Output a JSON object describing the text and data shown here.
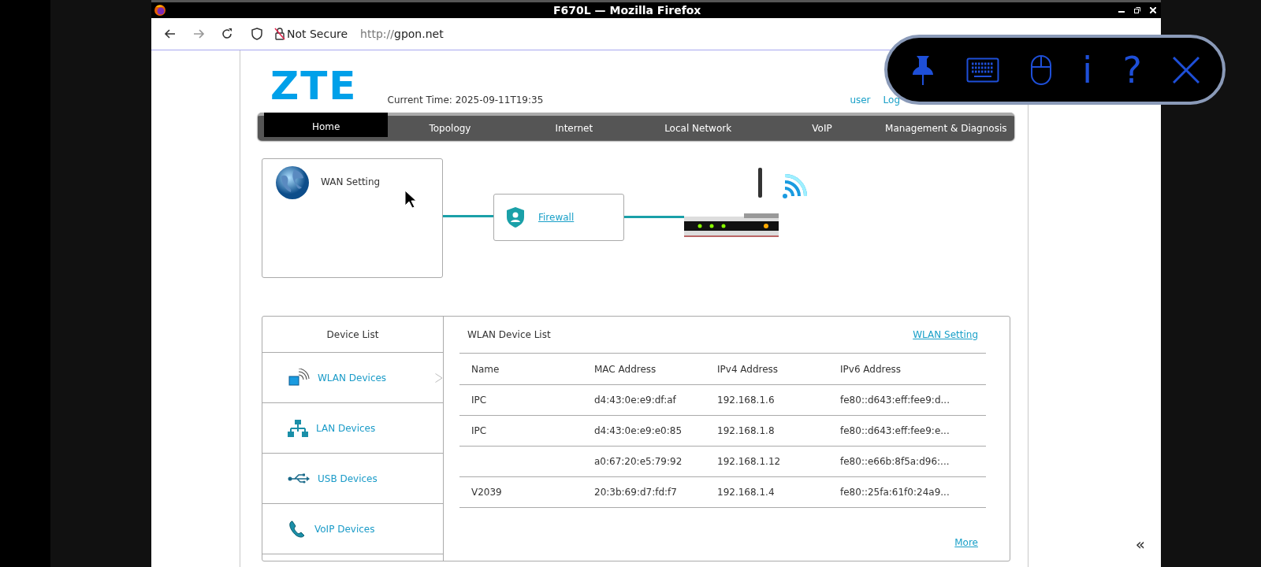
{
  "window": {
    "title": "F670L — Mozilla Firefox"
  },
  "address_bar": {
    "security": "Not Secure",
    "url_scheme": "http://",
    "url_host": "gpon.net"
  },
  "header": {
    "logo": "ZTE",
    "current_time": "Current Time: 2025-09-11T19:35",
    "links": [
      "user",
      "Log"
    ]
  },
  "nav": [
    {
      "label": "Home",
      "selected": true
    },
    {
      "label": "Topology",
      "selected": false
    },
    {
      "label": "Internet",
      "selected": false
    },
    {
      "label": "Local Network",
      "selected": false
    },
    {
      "label": "VoIP",
      "selected": false
    },
    {
      "label": "Management & Diagnosis",
      "selected": false
    }
  ],
  "topology": {
    "wan": "WAN Setting",
    "firewall": "Firewall"
  },
  "device_list": {
    "title": "Device List",
    "categories": [
      {
        "label": "WLAN Devices",
        "kind": "wlan",
        "selected": true
      },
      {
        "label": "LAN Devices",
        "kind": "lan",
        "selected": false
      },
      {
        "label": "USB Devices",
        "kind": "usb",
        "selected": false
      },
      {
        "label": "VoIP Devices",
        "kind": "voip",
        "selected": false
      }
    ]
  },
  "wlan_list": {
    "title": "WLAN Device List",
    "setting_link": "WLAN Setting",
    "columns": [
      "Name",
      "MAC Address",
      "IPv4 Address",
      "IPv6 Address"
    ],
    "rows": [
      [
        "IPC",
        "d4:43:0e:e9:df:af",
        "192.168.1.6",
        "fe80::d643:eff:fee9:d..."
      ],
      [
        "IPC",
        "d4:43:0e:e9:e0:85",
        "192.168.1.8",
        "fe80::d643:eff:fee9:e..."
      ],
      [
        "",
        "a0:67:20:e5:79:92",
        "192.168.1.12",
        "fe80::e66b:8f5a:d96:..."
      ],
      [
        "V2039",
        "20:3b:69:d7:fd:f7",
        "192.168.1.4",
        "fe80::25fa:61f0:24a9..."
      ]
    ],
    "more": "More"
  },
  "overlay": {
    "glyphs": [
      "i",
      "?"
    ]
  },
  "collapse": "«"
}
